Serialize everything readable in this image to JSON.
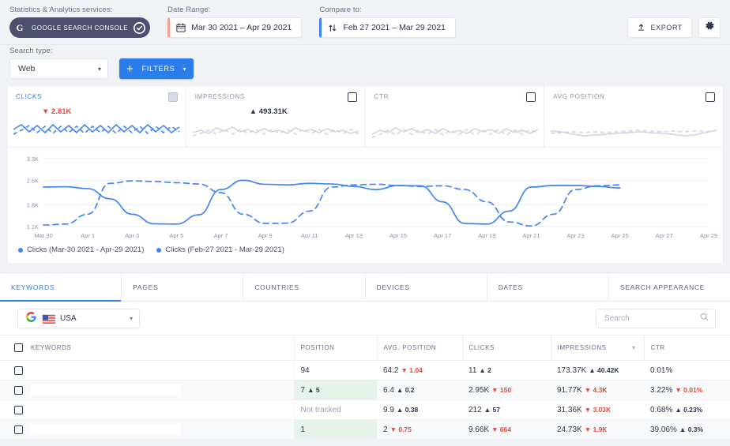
{
  "topbar": {
    "service_label": "Statistics & Analytics services:",
    "service_name": "GOOGLE SEARCH CONSOLE",
    "service_logo": "google-g-icon",
    "date_range_label": "Date Range:",
    "date_range_value": "Mar 30 2021 – Apr 29 2021",
    "compare_label": "Compare to:",
    "compare_value": "Feb 27 2021 – Mar 29 2021",
    "export_label": "EXPORT",
    "settings_icon": "gear-icon",
    "accent_blue": "#2b7de9",
    "accent_coral": "#f4a08a",
    "brand_dark": "#4e4e6e"
  },
  "searchtype": {
    "label": "Search type:",
    "value": "Web",
    "filters_label": "FILTERS"
  },
  "metric_cards": [
    {
      "title": "CLICKS",
      "value": "",
      "delta": "2.81K",
      "direction": "down",
      "checked": true,
      "active": true
    },
    {
      "title": "IMPRESSIONS",
      "value": "",
      "delta": "493.31K",
      "direction": "up",
      "checked": false,
      "active": false
    },
    {
      "title": "CTR",
      "value": "",
      "delta": "",
      "direction": "",
      "checked": false,
      "active": false
    },
    {
      "title": "AVG POSITION",
      "value": "",
      "delta": "",
      "direction": "",
      "checked": false,
      "active": false
    }
  ],
  "chart_data": {
    "type": "line",
    "title": "Clicks over time",
    "xlabel": "",
    "ylabel": "Clicks",
    "ylim": [
      1100,
      3300
    ],
    "yticks": [
      "1.1K",
      "1.8K",
      "2.6K",
      "3.3K"
    ],
    "ytick_values": [
      1100,
      1800,
      2600,
      3300
    ],
    "grid": true,
    "legend_position": "bottom-left",
    "x": [
      "Mar 30",
      "Mar 31",
      "Apr 1",
      "Apr 2",
      "Apr 3",
      "Apr 4",
      "Apr 5",
      "Apr 6",
      "Apr 7",
      "Apr 8",
      "Apr 9",
      "Apr 10",
      "Apr 11",
      "Apr 12",
      "Apr 13",
      "Apr 14",
      "Apr 15",
      "Apr 16",
      "Apr 17",
      "Apr 18",
      "Apr 19",
      "Apr 20",
      "Apr 21",
      "Apr 22",
      "Apr 23",
      "Apr 24",
      "Apr 25",
      "Apr 26",
      "Apr 27",
      "Apr 28",
      "Apr 29"
    ],
    "xticks": [
      "Mar 30",
      "Apr 1",
      "Apr 3",
      "Apr 5",
      "Apr 7",
      "Apr 9",
      "Apr 11",
      "Apr 13",
      "Apr 15",
      "Apr 17",
      "Apr 19",
      "Apr 21",
      "Apr 23",
      "Apr 25",
      "Apr 27",
      "Apr 29"
    ],
    "series": [
      {
        "name": "Clicks (Mar-30 2021 - Apr-29 2021)",
        "color": "#4285f4",
        "style": "solid",
        "values": [
          2380,
          2390,
          2330,
          2000,
          1500,
          1190,
          1180,
          1480,
          2300,
          2600,
          2470,
          2450,
          2500,
          2480,
          2400,
          2300,
          2430,
          2420,
          1900,
          1200,
          1180,
          1600,
          2380,
          2430,
          2430,
          2400,
          2350,
          2050,
          1300,
          1170,
          1200
        ]
      },
      {
        "name": "Clicks (Feb-27 2021 - Mar-29 2021)",
        "color": "#4285f4",
        "style": "dashed",
        "values": [
          1150,
          1180,
          1500,
          2500,
          2580,
          2560,
          2520,
          2480,
          2200,
          1500,
          1200,
          1210,
          1600,
          2380,
          2450,
          2470,
          2430,
          2400,
          2420,
          2300,
          1900,
          1250,
          1120,
          1500,
          2300,
          2420,
          2450,
          2450,
          2430,
          2420,
          2380
        ]
      }
    ],
    "legend": [
      "Clicks (Mar-30 2021 - Apr-29 2021)",
      "Clicks (Feb-27 2021 - Mar-29 2021)"
    ]
  },
  "tabs": [
    {
      "label": "KEYWORDS",
      "active": true
    },
    {
      "label": "PAGES",
      "active": false
    },
    {
      "label": "COUNTRIES",
      "active": false
    },
    {
      "label": "DEVICES",
      "active": false
    },
    {
      "label": "DATES",
      "active": false
    },
    {
      "label": "SEARCH APPEARANCE",
      "active": false
    }
  ],
  "table_filters": {
    "country_logo": "google-g-icon",
    "country_flag": "usa-flag-icon",
    "country_value": "USA",
    "search_placeholder": "Search",
    "search_value": ""
  },
  "table": {
    "headers": [
      "KEYWORDS",
      "POSITION",
      "AVG. POSITION",
      "CLICKS",
      "IMPRESSIONS",
      "CTR"
    ],
    "sorted_column": "IMPRESSIONS",
    "rows": [
      {
        "keyword": "",
        "position": "94",
        "position_state": "plain",
        "avg_position": "64.2",
        "avg_position_chg": "1.04",
        "avg_position_dir": "down",
        "clicks": "11",
        "clicks_chg": "2",
        "clicks_dir": "up",
        "impressions": "173.37K",
        "impressions_chg": "40.42K",
        "impressions_dir": "up",
        "ctr": "0.01%",
        "ctr_chg": "",
        "ctr_dir": ""
      },
      {
        "keyword": "",
        "position": "7",
        "position_chg": "5",
        "position_dir": "up",
        "position_state": "good",
        "avg_position": "6.4",
        "avg_position_chg": "0.2",
        "avg_position_dir": "up",
        "clicks": "2.95K",
        "clicks_chg": "150",
        "clicks_dir": "down",
        "impressions": "91.77K",
        "impressions_chg": "4.3K",
        "impressions_dir": "down",
        "ctr": "3.22%",
        "ctr_chg": "0.01%",
        "ctr_dir": "down"
      },
      {
        "keyword": "",
        "position": "Not tracked",
        "position_state": "none",
        "avg_position": "9.9",
        "avg_position_chg": "0.38",
        "avg_position_dir": "up",
        "clicks": "212",
        "clicks_chg": "57",
        "clicks_dir": "up",
        "impressions": "31.36K",
        "impressions_chg": "3.03K",
        "impressions_dir": "down",
        "ctr": "0.68%",
        "ctr_chg": "0.23%",
        "ctr_dir": "up"
      },
      {
        "keyword": "",
        "position": "1",
        "position_state": "good",
        "avg_position": "2",
        "avg_position_chg": "0.75",
        "avg_position_dir": "down",
        "clicks": "9.66K",
        "clicks_chg": "664",
        "clicks_dir": "down",
        "impressions": "24.73K",
        "impressions_chg": "1.9K",
        "impressions_dir": "down",
        "ctr": "39.06%",
        "ctr_chg": "0.3%",
        "ctr_dir": "up"
      }
    ]
  }
}
